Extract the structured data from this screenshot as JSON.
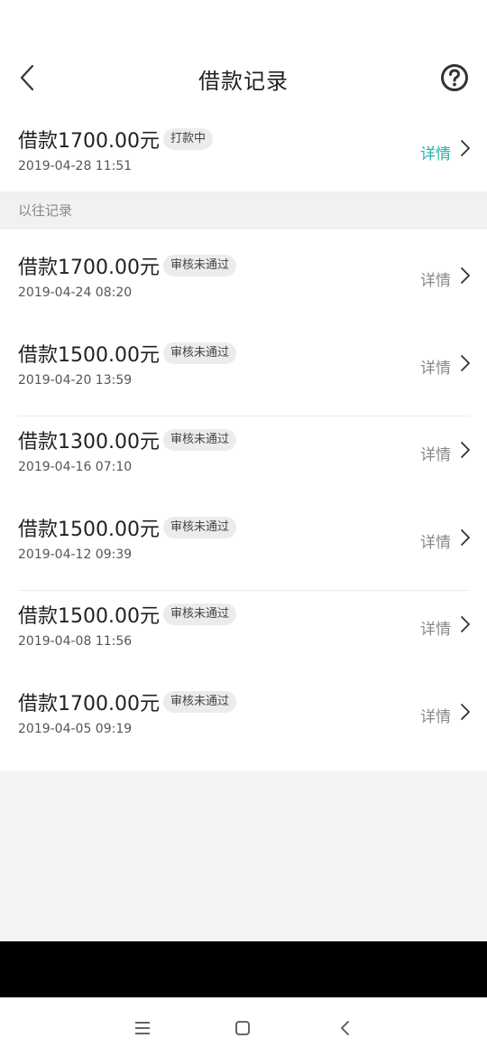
{
  "header": {
    "title": "借款记录"
  },
  "current": {
    "amount": "借款1700.00元",
    "status": "打款中",
    "time": "2019-04-28 11:51",
    "detail_label": "详情"
  },
  "section": {
    "label": "以往记录"
  },
  "records": [
    {
      "amount": "借款1700.00元",
      "status": "审核未通过",
      "time": "2019-04-24 08:20",
      "detail_label": "详情"
    },
    {
      "amount": "借款1500.00元",
      "status": "审核未通过",
      "time": "2019-04-20 13:59",
      "detail_label": "详情"
    },
    {
      "amount": "借款1300.00元",
      "status": "审核未通过",
      "time": "2019-04-16 07:10",
      "detail_label": "详情"
    },
    {
      "amount": "借款1500.00元",
      "status": "审核未通过",
      "time": "2019-04-12 09:39",
      "detail_label": "详情"
    },
    {
      "amount": "借款1500.00元",
      "status": "审核未通过",
      "time": "2019-04-08 11:56",
      "detail_label": "详情"
    },
    {
      "amount": "借款1700.00元",
      "status": "审核未通过",
      "time": "2019-04-05 09:19",
      "detail_label": "详情"
    }
  ],
  "icons": {
    "back": "back-chevron-icon",
    "help": "question-circle-icon",
    "detail": "chevron-right-icon",
    "nav_menu": "menu-lines-icon",
    "nav_home": "square-icon",
    "nav_back": "back-arrow-icon"
  },
  "colors": {
    "accent": "#1fb6a9",
    "muted": "#888888",
    "badge_bg": "#ececec",
    "page_bg": "#f4f4f4"
  }
}
